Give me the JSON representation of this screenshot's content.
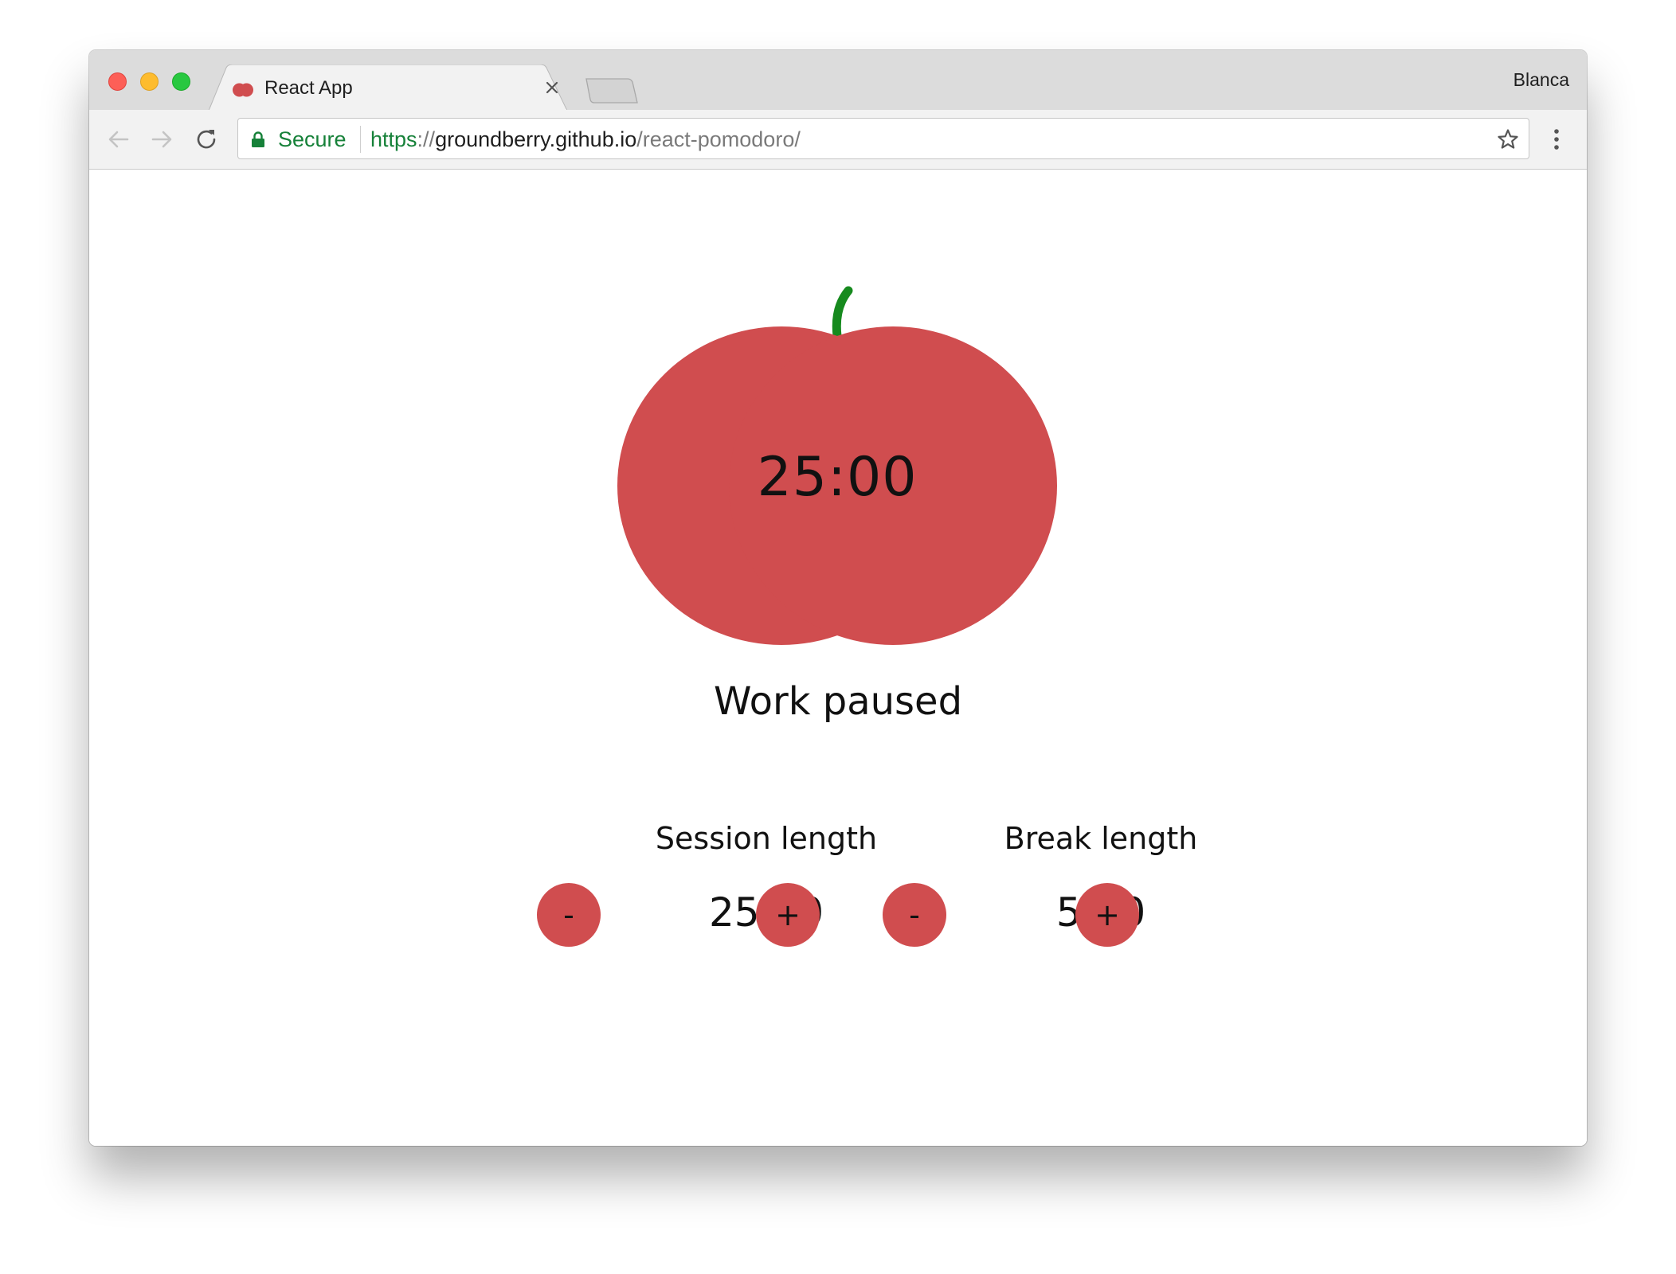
{
  "browser": {
    "profile_name": "Blanca",
    "tab": {
      "title": "React App",
      "favicon": "tomato-icon"
    },
    "address_bar": {
      "secure_label": "Secure",
      "url_scheme": "https",
      "url_separator": "://",
      "url_host": "groundberry.github.io",
      "url_path": "/react-pomodoro/"
    },
    "icons": {
      "back": "arrow-left-icon",
      "forward": "arrow-right-icon",
      "reload": "reload-icon",
      "lock": "lock-icon",
      "bookmark": "star-icon",
      "menu": "kebab-menu-icon",
      "close_tab": "close-icon"
    }
  },
  "app": {
    "timer": "25:00",
    "status": "Work paused",
    "session": {
      "label": "Session length",
      "value": "25:00",
      "decrement_label": "-",
      "increment_label": "+"
    },
    "break": {
      "label": "Break length",
      "value": "5:00",
      "decrement_label": "-",
      "increment_label": "+"
    },
    "colors": {
      "tomato": "#d04d4f",
      "stem": "#168a1e",
      "secure": "#168139"
    }
  }
}
